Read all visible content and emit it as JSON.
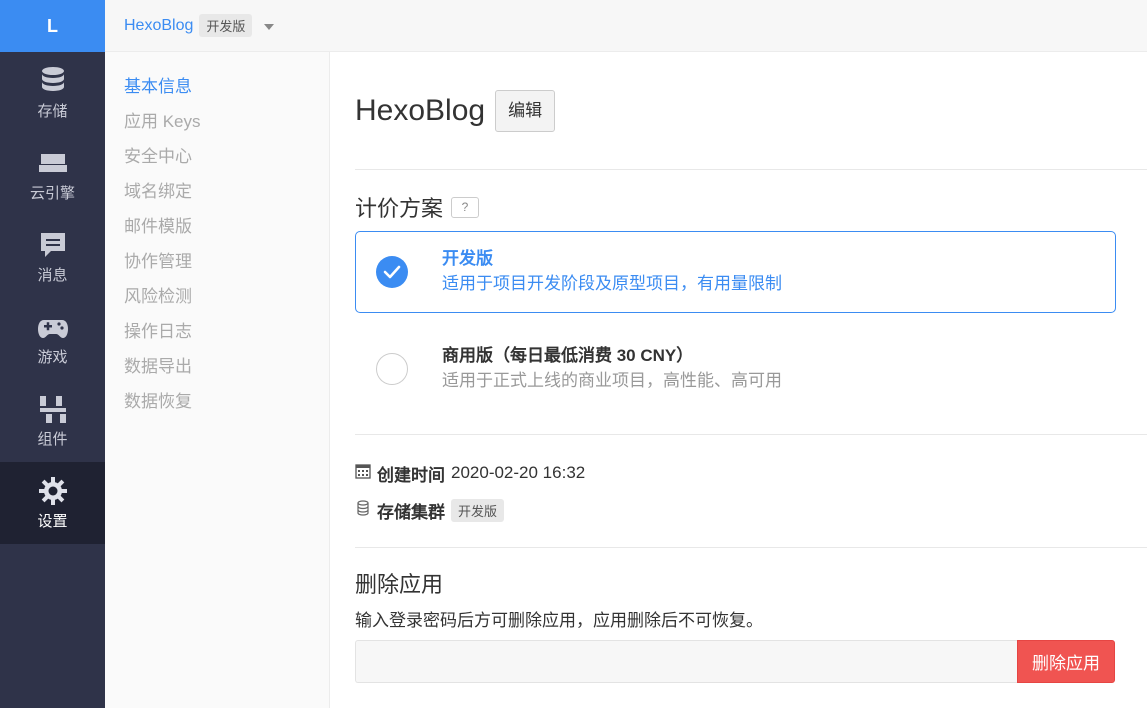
{
  "rail": {
    "logo": "L",
    "items": [
      {
        "label": "存储",
        "icon": "database-icon"
      },
      {
        "label": "云引擎",
        "icon": "cloud-engine-icon"
      },
      {
        "label": "消息",
        "icon": "message-icon"
      },
      {
        "label": "游戏",
        "icon": "gamepad-icon"
      },
      {
        "label": "组件",
        "icon": "components-icon"
      },
      {
        "label": "设置",
        "icon": "gear-icon",
        "active": true
      }
    ]
  },
  "topbar": {
    "app_name": "HexoBlog",
    "plan_tag": "开发版"
  },
  "submenu": {
    "items": [
      "基本信息",
      "应用 Keys",
      "安全中心",
      "域名绑定",
      "邮件模版",
      "协作管理",
      "风险检测",
      "操作日志",
      "数据导出",
      "数据恢复"
    ],
    "active_index": 0
  },
  "main": {
    "app_title": "HexoBlog",
    "edit_label": "编辑",
    "pricing_title": "计价方案",
    "help_label": "?",
    "plans": [
      {
        "name": "开发版",
        "desc": "适用于项目开发阶段及原型项目，有用量限制",
        "selected": true
      },
      {
        "name": "商用版（每日最低消费 30 CNY）",
        "desc": "适用于正式上线的商业项目，高性能、高可用",
        "selected": false
      }
    ],
    "created_label": "创建时间",
    "created_value": "2020-02-20 16:32",
    "cluster_label": "存储集群",
    "cluster_value": "开发版",
    "delete_title": "删除应用",
    "delete_desc": "输入登录密码后方可删除应用，应用删除后不可恢复。",
    "password_value": "",
    "delete_button": "删除应用"
  },
  "colors": {
    "accent": "#3b8cf2",
    "rail_bg": "#2f3349",
    "rail_active_bg": "#1f2232",
    "danger": "#f05451"
  }
}
